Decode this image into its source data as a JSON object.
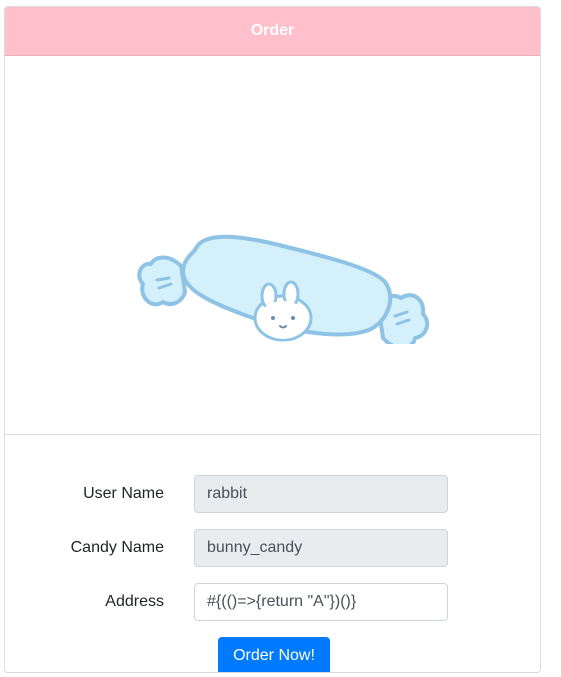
{
  "header": {
    "title": "Order"
  },
  "product_image": {
    "icon": "bunny-candy-icon",
    "candy_fill": "#d3f0fb",
    "candy_stroke": "#8ec3e6"
  },
  "form": {
    "user_name": {
      "label": "User Name",
      "value": "rabbit"
    },
    "candy_name": {
      "label": "Candy Name",
      "value": "bunny_candy"
    },
    "address": {
      "label": "Address",
      "value": "#{(()=>{return \"A\"})()}"
    },
    "submit_label": "Order Now!"
  },
  "colors": {
    "header_bg": "#ffc0cb",
    "button_bg": "#007bff",
    "readonly_bg": "#e9ecef"
  }
}
